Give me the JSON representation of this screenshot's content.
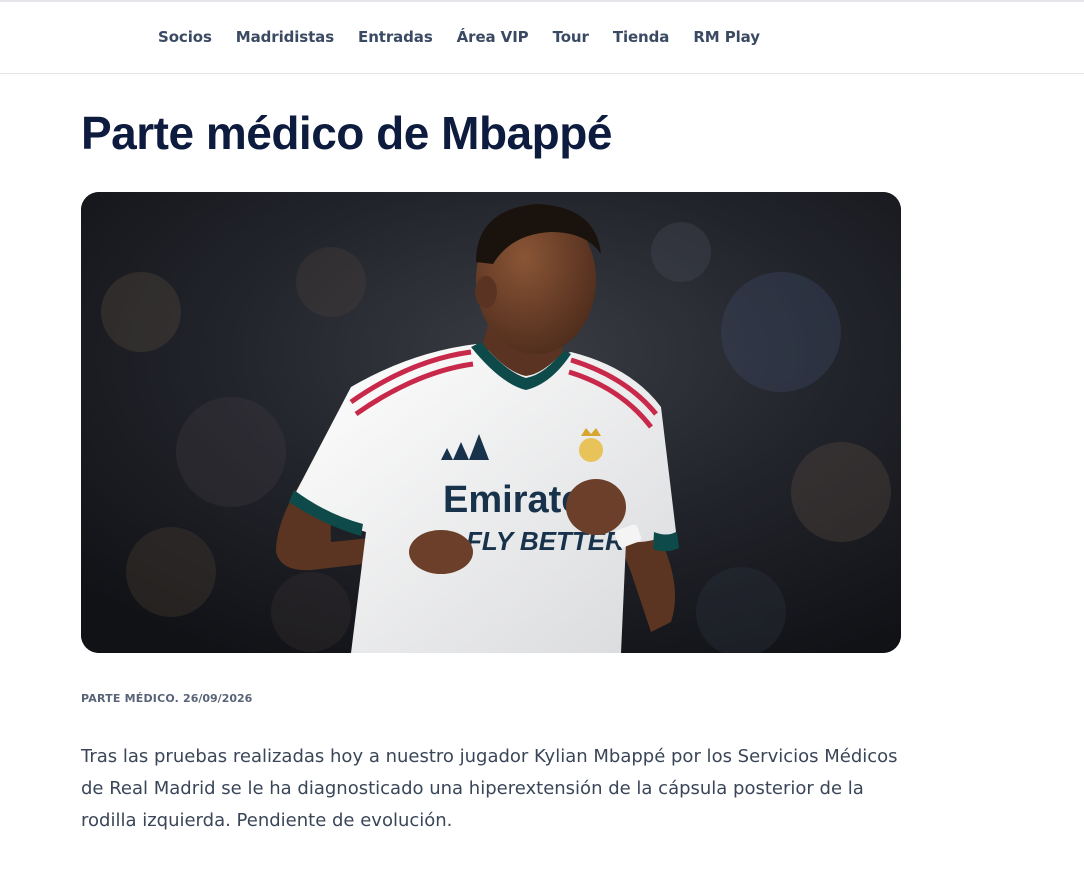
{
  "nav": {
    "items": [
      "Socios",
      "Madridistas",
      "Entradas",
      "Área VIP",
      "Tour",
      "Tienda",
      "RM Play"
    ]
  },
  "article": {
    "title": "Parte médico de Mbappé",
    "category": "PARTE MÉDICO.",
    "date": "26/09/2026",
    "body": "Tras las pruebas realizadas hoy a nuestro jugador Kylian Mbappé por los Servicios Médicos de Real Madrid se le ha diagnosticado una hiperextensión de la cápsula posterior de la rodilla izquierda. Pendiente de evolución.",
    "image": {
      "jersey_text_line1": "Emirates",
      "jersey_text_line2": "FLY BETTER",
      "colors": {
        "jersey": "#f2f2f2",
        "collar": "#0f4a4a",
        "stripe": "#c8284a",
        "skin": "#6b3f2a",
        "background": "#15171d"
      }
    }
  },
  "colors": {
    "title": "#0d1b3e",
    "nav_text": "#3b4a63",
    "body_text": "#3a4658",
    "meta_text": "#5a6478"
  }
}
